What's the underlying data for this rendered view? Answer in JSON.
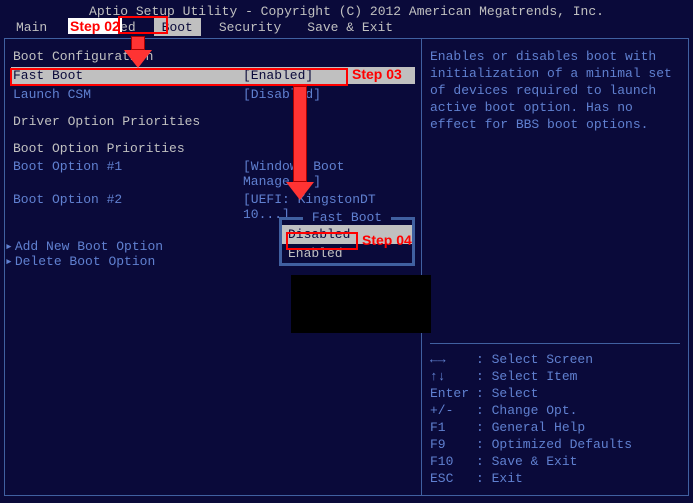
{
  "title": "Aptio Setup Utility - Copyright (C) 2012 American Megatrends, Inc.",
  "menu": [
    "Main",
    "Advanced",
    "Boot",
    "Security",
    "Save & Exit"
  ],
  "menu_selected": "Boot",
  "left": {
    "section1_heading": "Boot Configuration",
    "fastboot_label": "Fast Boot",
    "fastboot_value": "[Enabled]",
    "launchcsm_label": "Launch CSM",
    "launchcsm_value": "[Disabled]",
    "section2_heading": "Driver Option Priorities",
    "section3_heading": "Boot Option Priorities",
    "boot1_label": "Boot Option #1",
    "boot1_value": "[Windows Boot Manage...]",
    "boot2_label": "Boot Option #2",
    "boot2_value": "[UEFI: KingstonDT 10...]",
    "add_boot_label": "Add New Boot Option",
    "del_boot_label": "Delete Boot Option"
  },
  "popup": {
    "title": "Fast Boot",
    "opt_disabled": "Disabled",
    "opt_enabled": "Enabled"
  },
  "right": {
    "desc": "Enables or disables boot with initialization of a minimal set of devices required to launch active boot option. Has no effect for BBS boot options.",
    "help": [
      {
        "key": "←→",
        "text": ": Select Screen"
      },
      {
        "key": "↑↓",
        "text": ": Select Item"
      },
      {
        "key": "Enter",
        "text": ": Select"
      },
      {
        "key": "+/-",
        "text": ": Change Opt."
      },
      {
        "key": "F1",
        "text": ": General Help"
      },
      {
        "key": "F9",
        "text": ": Optimized Defaults"
      },
      {
        "key": "F10",
        "text": ": Save & Exit"
      },
      {
        "key": "ESC",
        "text": ": Exit"
      }
    ]
  },
  "annotations": {
    "step02": "Step 02",
    "step03": "Step 03",
    "step04": "Step 04"
  }
}
